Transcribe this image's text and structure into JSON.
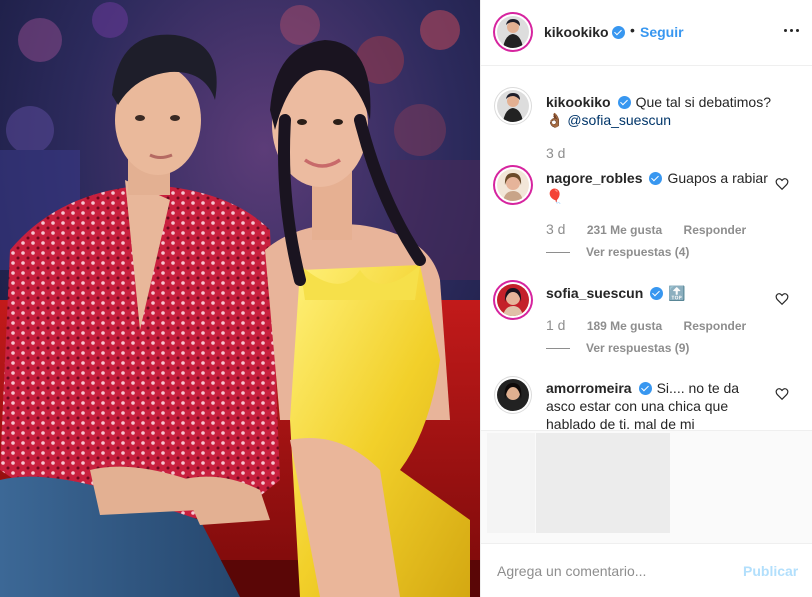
{
  "post": {
    "author": "kikookiko",
    "follow_label": "Seguir",
    "separator": "•",
    "caption_text": "Que tal si debatimos?",
    "caption_emoji": "👌🏾",
    "caption_mention": "@sofia_suescun",
    "caption_time": "3 d"
  },
  "comments": [
    {
      "username": "nagore_robles",
      "text": "Guapos a rabiar",
      "emoji": "🎈",
      "time": "3 d",
      "likes": "231 Me gusta",
      "reply_label": "Responder",
      "view_replies": "Ver respuestas (4)"
    },
    {
      "username": "sofia_suescun",
      "text": "",
      "emoji": "🔝",
      "time": "1 d",
      "likes": "189 Me gusta",
      "reply_label": "Responder",
      "view_replies": "Ver respuestas (9)"
    },
    {
      "username": "amorromeira",
      "text": "Si.... no te da asco estar con una chica que hablado de ti, mal de mi"
    }
  ],
  "add_comment": {
    "placeholder": "Agrega un comentario...",
    "publish_label": "Publicar"
  },
  "colors": {
    "link_blue": "#3897f0",
    "publish_disabled": "#b2dffc",
    "secondary_text": "#8e8e8e",
    "border": "#efefef"
  }
}
